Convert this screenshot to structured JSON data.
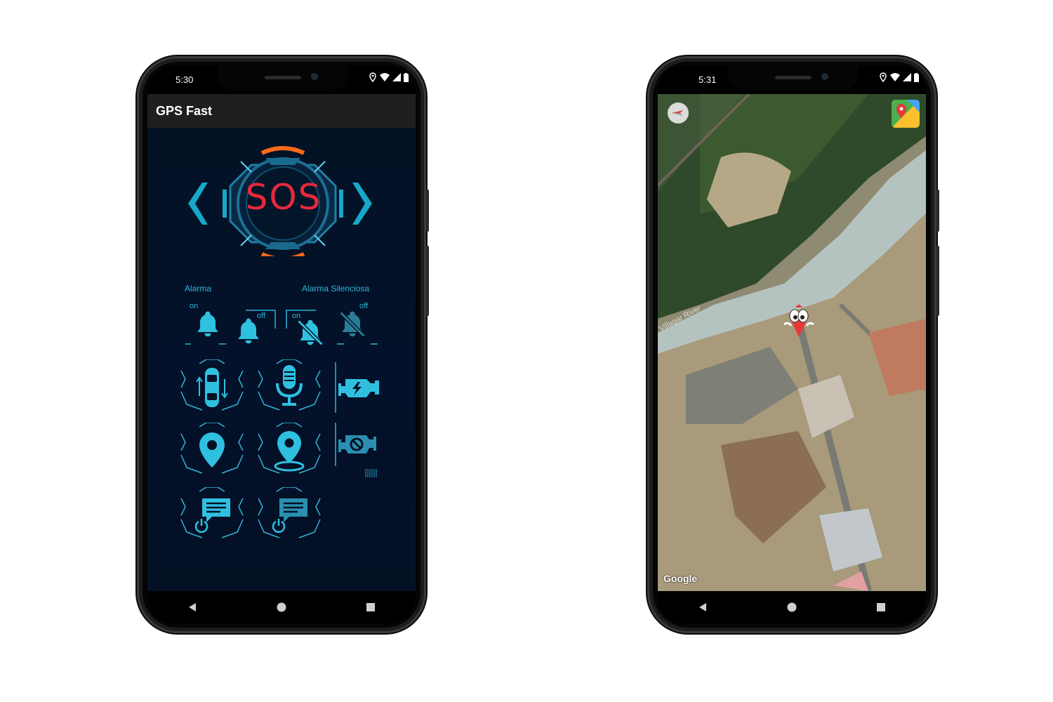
{
  "phone_left": {
    "status": {
      "time": "5:30"
    },
    "app_title": "GPS Fast",
    "sos_label": "SOS",
    "alarm_label": "Alarma",
    "silent_alarm_label": "Alarma Silenciosa",
    "toggle_on": "on",
    "toggle_off": "off",
    "colors": {
      "accent": "#2fb6d6",
      "sos_red": "#e8283c",
      "orange": "#ff6a1a",
      "background": "#041226"
    }
  },
  "phone_right": {
    "status": {
      "time": "5:31"
    },
    "map_river_label": "Villagar River",
    "map_watermark": "Google"
  },
  "icons": [
    "back-icon",
    "home-icon",
    "recents-icon",
    "location-icon",
    "wifi-icon",
    "signal-icon",
    "battery-icon",
    "bell-icon",
    "bell-off-icon",
    "car-icon",
    "microphone-icon",
    "engine-on-icon",
    "engine-off-icon",
    "map-pin-icon",
    "message-icon",
    "power-icon",
    "compass-icon",
    "maps-app-icon"
  ]
}
